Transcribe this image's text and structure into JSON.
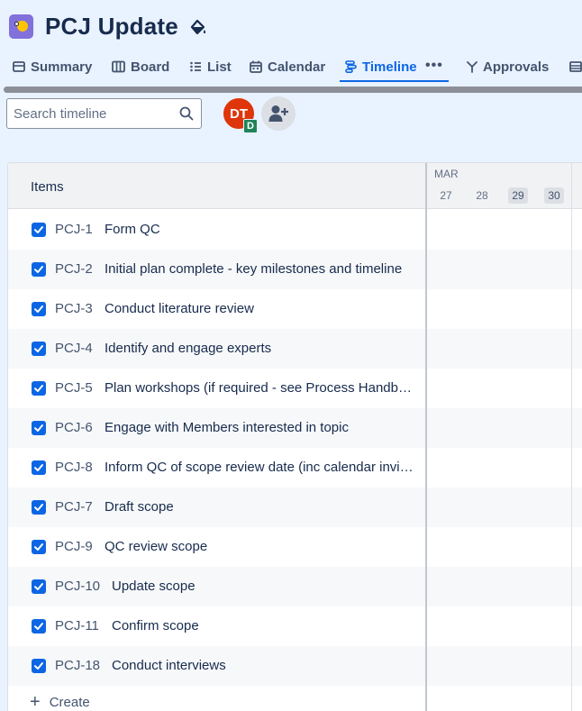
{
  "header": {
    "title": "PCJ Update"
  },
  "tabs": [
    {
      "label": "Summary",
      "icon": "summary-icon"
    },
    {
      "label": "Board",
      "icon": "board-icon"
    },
    {
      "label": "List",
      "icon": "list-icon"
    },
    {
      "label": "Calendar",
      "icon": "calendar-icon"
    },
    {
      "label": "Timeline",
      "icon": "timeline-icon",
      "active": true
    },
    {
      "label": "Approvals",
      "icon": "approvals-icon"
    }
  ],
  "toolbar": {
    "search_placeholder": "Search timeline",
    "avatar_initials": "DT",
    "avatar_badge": "D"
  },
  "timeline": {
    "items_header": "Items",
    "month": "MAR",
    "days": [
      "27",
      "28",
      "29",
      "30"
    ]
  },
  "items": [
    {
      "key": "PCJ-1",
      "summary": "Form QC",
      "done": true
    },
    {
      "key": "PCJ-2",
      "summary": "Initial plan complete - key milestones and timeline",
      "done": true
    },
    {
      "key": "PCJ-3",
      "summary": "Conduct literature review",
      "done": true
    },
    {
      "key": "PCJ-4",
      "summary": "Identify and engage experts",
      "done": true
    },
    {
      "key": "PCJ-5",
      "summary": "Plan workshops (if required - see Process Handbook)",
      "done": true
    },
    {
      "key": "PCJ-6",
      "summary": "Engage with Members interested in topic",
      "done": true
    },
    {
      "key": "PCJ-8",
      "summary": "Inform QC of scope review date (inc calendar invite)",
      "done": true
    },
    {
      "key": "PCJ-7",
      "summary": "Draft scope",
      "done": true
    },
    {
      "key": "PCJ-9",
      "summary": "QC review scope",
      "done": true
    },
    {
      "key": "PCJ-10",
      "summary": "Update scope",
      "done": true
    },
    {
      "key": "PCJ-11",
      "summary": "Confirm scope",
      "done": true
    },
    {
      "key": "PCJ-18",
      "summary": "Conduct interviews",
      "done": true
    }
  ],
  "create_label": "Create",
  "colors": {
    "accent": "#0c66e4",
    "background": "#e9f2ff",
    "avatar": "#de350b",
    "badge": "#1f845a"
  }
}
